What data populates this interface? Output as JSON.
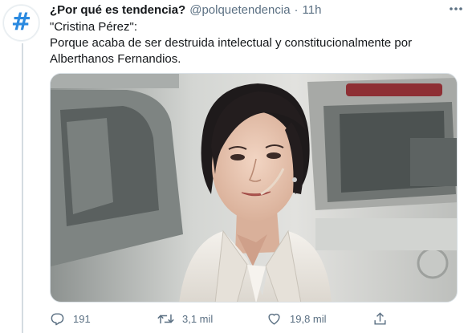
{
  "tweet": {
    "author_name": "¿Por qué es tendencia?",
    "handle": "@polquetendencia",
    "separator": "·",
    "time": "11h",
    "text_lines": [
      "\"Cristina Pérez\":",
      "Porque acaba de ser destruida intelectual y constitucionalmente por",
      "Alberthanos Fernandios."
    ],
    "avatar_glyph": "#",
    "colors": {
      "avatar_hash": "#2b8ae0",
      "secondary_text": "#5b7083",
      "primary_text": "#14171a"
    }
  },
  "actions": {
    "reply": {
      "icon": "reply-icon",
      "count": "191"
    },
    "retweet": {
      "icon": "retweet-icon",
      "count": "3,1 mil"
    },
    "like": {
      "icon": "heart-icon",
      "count": "19,8 mil"
    },
    "share": {
      "icon": "share-icon"
    }
  },
  "media": {
    "icon": "photo"
  }
}
